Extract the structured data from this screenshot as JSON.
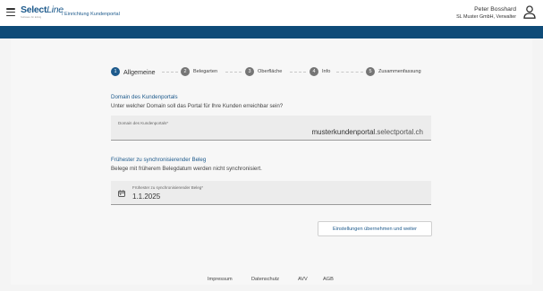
{
  "header": {
    "logo_select": "Select",
    "logo_line": "Line",
    "logo_tagline": "Software für Erfolg",
    "breadcrumb": "/ Einrichtung Kundenportal",
    "user_name": "Peter Bosshard",
    "user_company": "SL Muster GmbH, Verwalter"
  },
  "stepper": {
    "steps": [
      {
        "num": "1",
        "label": "Allgemeine"
      },
      {
        "num": "2",
        "label": "Belegarten"
      },
      {
        "num": "3",
        "label": "Oberfläche"
      },
      {
        "num": "4",
        "label": "Info"
      },
      {
        "num": "5",
        "label": "Zusammenfassung"
      }
    ]
  },
  "domain": {
    "title": "Domain des Kundenportals",
    "description": "Unter welcher Domain soll das Portal für Ihre Kunden erreichbar sein?",
    "field_label": "Domain des Kundenportals*",
    "value_prefix": "musterkundenportal",
    "value_suffix": ".selectportal.ch"
  },
  "earliest": {
    "title": "Frühester zu synchronisierender Beleg",
    "description": "Belege mit früherem Belegdatum werden nicht synchronisiert.",
    "field_label": "Frühester zu synchronisierender Beleg*",
    "value": "1.1.2025"
  },
  "actions": {
    "submit_label": "Einstellungen übernehmen und weiter"
  },
  "footer": {
    "links": [
      "Impressum",
      "Datenschutz",
      "AVV",
      "AGB"
    ]
  },
  "colors": {
    "brand": "#0e4b78",
    "accent": "#1d5a8c",
    "step_inactive": "#757575"
  }
}
